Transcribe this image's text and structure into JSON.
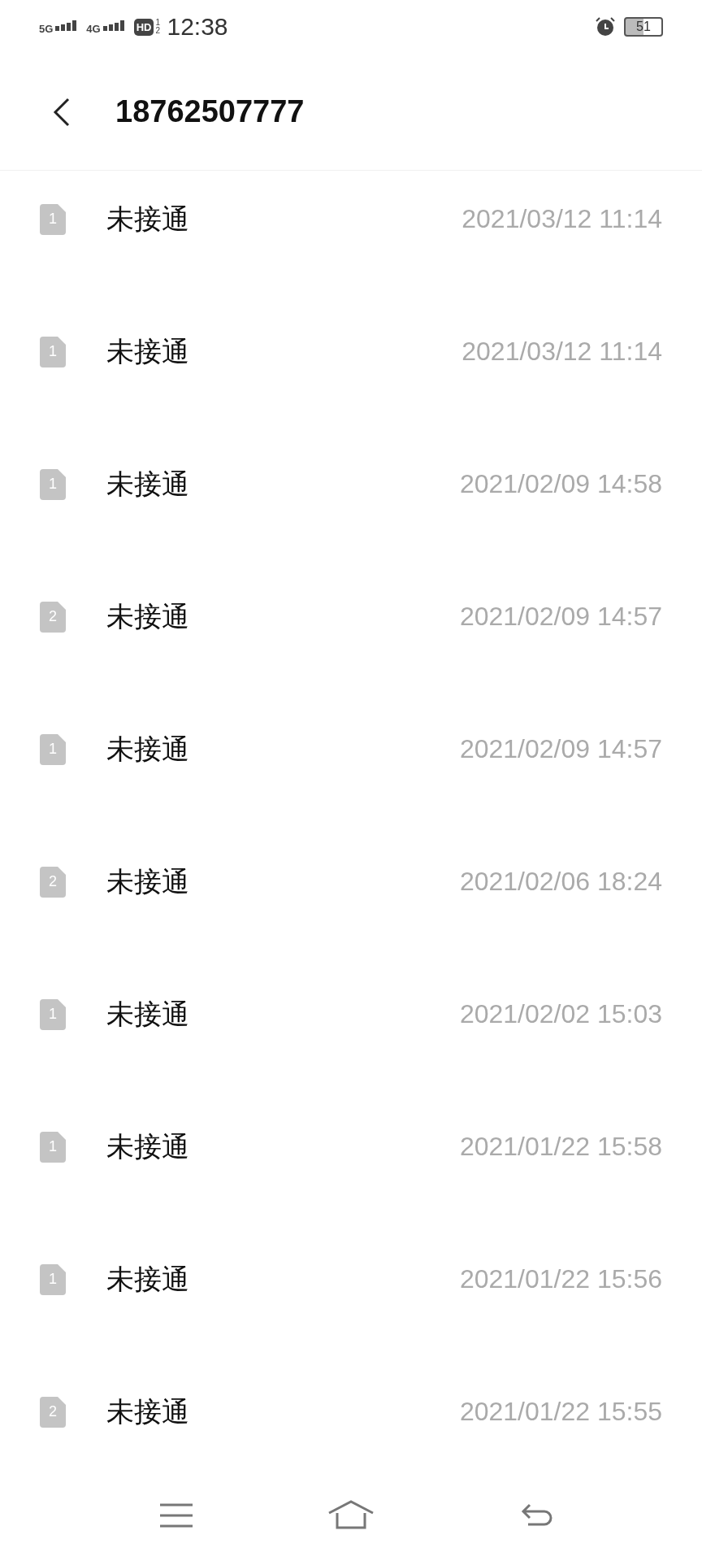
{
  "status_bar": {
    "network_1": "5G",
    "network_2": "4G",
    "hd": "HD",
    "hd_slots": "1 2",
    "time": "12:38",
    "battery": "51"
  },
  "header": {
    "title": "18762507777"
  },
  "calls": [
    {
      "sim": "1",
      "status": "未接通",
      "time": "2021/03/12 11:14"
    },
    {
      "sim": "1",
      "status": "未接通",
      "time": "2021/03/12 11:14"
    },
    {
      "sim": "1",
      "status": "未接通",
      "time": "2021/02/09 14:58"
    },
    {
      "sim": "2",
      "status": "未接通",
      "time": "2021/02/09 14:57"
    },
    {
      "sim": "1",
      "status": "未接通",
      "time": "2021/02/09 14:57"
    },
    {
      "sim": "2",
      "status": "未接通",
      "time": "2021/02/06 18:24"
    },
    {
      "sim": "1",
      "status": "未接通",
      "time": "2021/02/02 15:03"
    },
    {
      "sim": "1",
      "status": "未接通",
      "time": "2021/01/22 15:58"
    },
    {
      "sim": "1",
      "status": "未接通",
      "time": "2021/01/22 15:56"
    },
    {
      "sim": "2",
      "status": "未接通",
      "time": "2021/01/22 15:55"
    }
  ]
}
